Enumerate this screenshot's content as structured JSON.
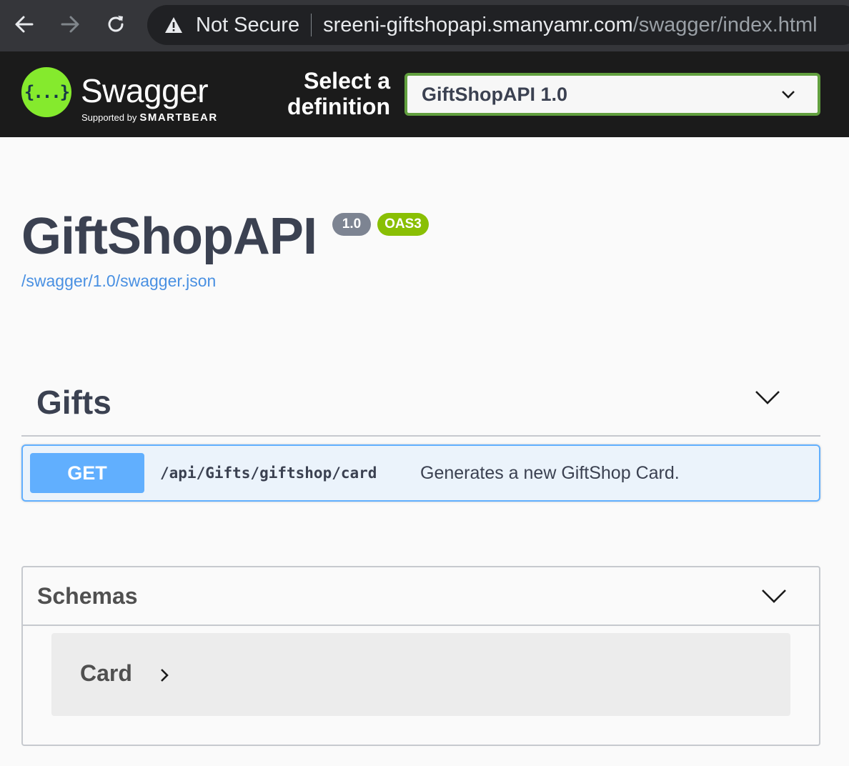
{
  "browser": {
    "security_label": "Not Secure",
    "url_host": "sreeni-giftshopapi.smanyamr.com",
    "url_path": "/swagger/index.html",
    "icons": [
      "back-arrow-icon",
      "forward-arrow-icon",
      "reload-icon",
      "warning-icon"
    ]
  },
  "topbar": {
    "logo_text": "Swagger",
    "logo_glyph": "{...}",
    "supported_by": "Supported by",
    "smartbear": "SMARTBEAR",
    "select_label": "Select a definition",
    "definition_selected": "GiftShopAPI 1.0",
    "accent_color": "#85ea2d",
    "select_border_color": "#62a03f"
  },
  "info": {
    "title": "GiftShopAPI",
    "version_badge": "1.0",
    "oas_badge": "OAS3",
    "spec_link": "/swagger/1.0/swagger.json"
  },
  "tags": [
    {
      "name": "Gifts",
      "operations": [
        {
          "method": "GET",
          "path": "/api/Gifts/giftshop/card",
          "summary": "Generates a new GiftShop Card.",
          "method_color": "#61affe"
        }
      ]
    }
  ],
  "schemas": {
    "title": "Schemas",
    "models": [
      {
        "name": "Card"
      }
    ]
  }
}
